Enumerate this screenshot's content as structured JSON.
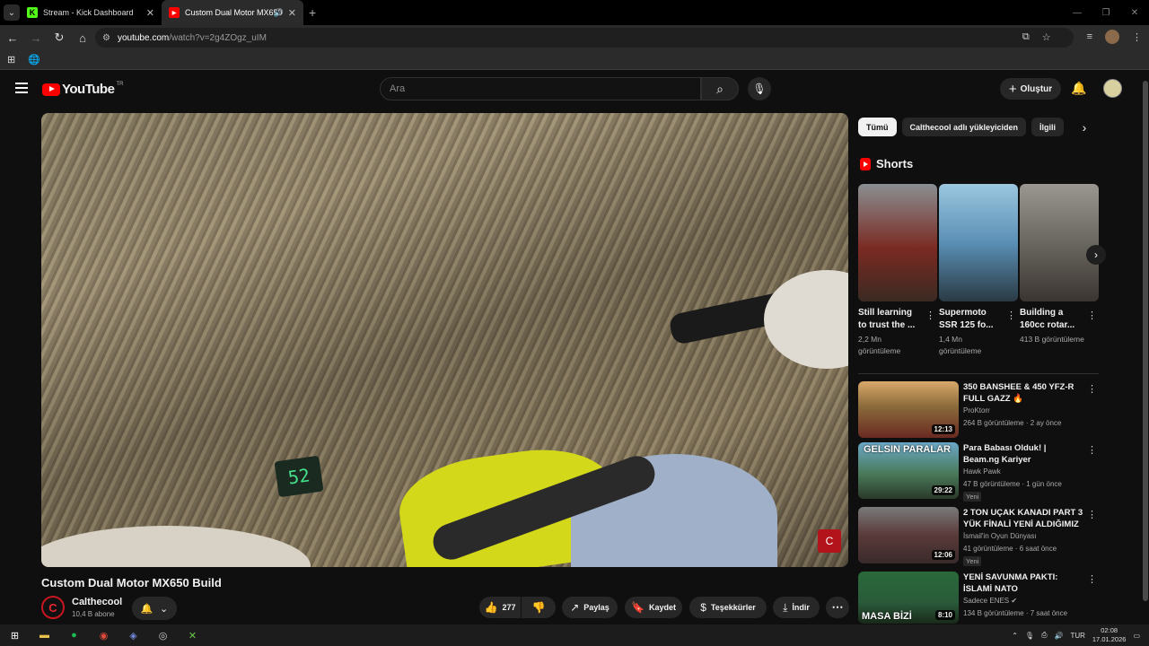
{
  "browser": {
    "tabs": [
      {
        "title": "Stream - Kick Dashboard",
        "favicon": "K",
        "active": false
      },
      {
        "title": "Custom Dual Motor MX650",
        "favicon": "▶",
        "active": true
      }
    ],
    "url_host": "youtube.com",
    "url_rest": "/watch?v=2g4ZOgz_uIM"
  },
  "yt": {
    "logo_text": "YouTube",
    "region": "TR",
    "search_placeholder": "Ara",
    "create_label": "Oluştur"
  },
  "video": {
    "title": "Custom Dual Motor MX650 Build",
    "speed_display": "52",
    "channel_name": "Calthecool",
    "channel_subs": "10,4 B abone",
    "channel_initial": "C",
    "likes": "277",
    "share_label": "Paylaş",
    "save_label": "Kaydet",
    "thanks_label": "Teşekkürler",
    "download_label": "İndir"
  },
  "chips": [
    "Tümü",
    "Calthecool adlı yükleyiciden",
    "İlgili"
  ],
  "shorts": {
    "heading": "Shorts",
    "items": [
      {
        "title": "Still learning to trust the ...",
        "views": "2,2 Mn görüntüleme",
        "color": "#7a2a22"
      },
      {
        "title": "Supermoto SSR 125 fo...",
        "views": "1,4 Mn görüntüleme",
        "color": "#5a8fb5"
      },
      {
        "title": "Building a 160cc rotar...",
        "views": "413 B görüntüleme",
        "color": "#6a6660"
      }
    ]
  },
  "related": [
    {
      "title": "350 BANSHEE & 450 YFZ-R FULL GAZZ 🔥",
      "channel": "ProKtorr",
      "meta": "264 B görüntüleme · 2 ay önce",
      "duration": "12:13",
      "badge": "",
      "color": "#8a6a3a"
    },
    {
      "title": "Para Babası Olduk! | Beam.ng Kariyer",
      "channel": "Hawk Pawk",
      "meta": "47 B görüntüleme · 1 gün önce",
      "duration": "29:22",
      "badge": "Yeni",
      "color": "#4a7a5a",
      "overlay": "GELSIN PARALAR"
    },
    {
      "title": "2 TON UÇAK KANADI PART 3 YÜK FİNALİ YENİ ALDIĞIMIZ T...",
      "channel": "İsmail'in Oyun Dünyası",
      "meta": "41 görüntüleme · 6 saat önce",
      "duration": "12:06",
      "badge": "Yeni",
      "color": "#5a3a3a"
    },
    {
      "title": "YENİ SAVUNMA PAKTI: İSLAMİ NATO",
      "channel": "Sadece ENES",
      "meta": "134 B görüntüleme · 7 saat önce",
      "duration": "8:10",
      "badge": "",
      "color": "#2a5a3a",
      "overlay": "MASA BİZİ"
    }
  ],
  "taskbar": {
    "lang": "TUR",
    "time": "02:08",
    "date": "17.01.2026"
  }
}
